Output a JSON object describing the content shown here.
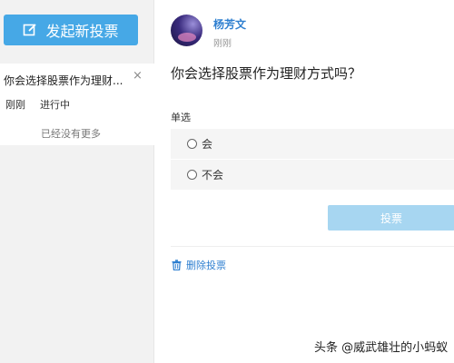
{
  "sidebar": {
    "new_vote_label": "发起新投票",
    "vote_item": {
      "title": "你会选择股票作为理财...",
      "close": "×",
      "time": "刚刚",
      "status": "进行中"
    },
    "no_more": "已经没有更多"
  },
  "post": {
    "author": "杨芳文",
    "time": "刚刚",
    "question": "你会选择股票作为理财方式吗？",
    "vote_type": "单选",
    "options": [
      {
        "label": "会"
      },
      {
        "label": "不会"
      }
    ],
    "submit_label": "投票",
    "delete_label": "删除投票"
  },
  "watermark": "头条 @威武雄壮的小蚂蚁",
  "colors": {
    "accent": "#46a8e6",
    "link": "#2e7fd0",
    "submit_disabled": "#a7d6f1"
  }
}
